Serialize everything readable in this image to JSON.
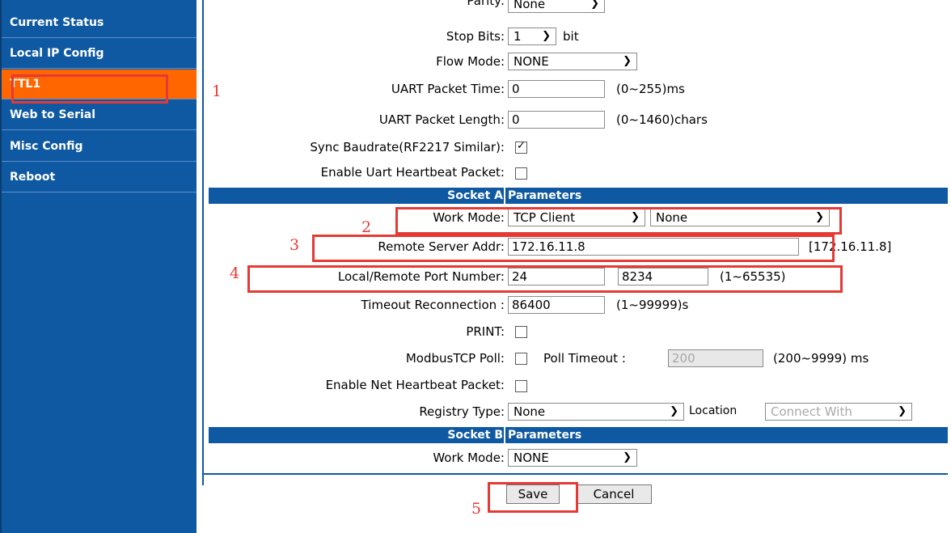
{
  "sidebar": {
    "items": [
      {
        "label": "Current Status",
        "active": false
      },
      {
        "label": "Local IP Config",
        "active": false
      },
      {
        "label": "TTL1",
        "active": true
      },
      {
        "label": "Web to Serial",
        "active": false
      },
      {
        "label": "Misc Config",
        "active": false
      },
      {
        "label": "Reboot",
        "active": false
      }
    ]
  },
  "uart": {
    "parity_label": "Parity:",
    "parity_value": "None",
    "stop_bits_label": "Stop Bits:",
    "stop_bits_value": "1",
    "stop_bits_unit": "bit",
    "flow_mode_label": "Flow Mode:",
    "flow_mode_value": "NONE",
    "packet_time_label": "UART Packet Time:",
    "packet_time_value": "0",
    "packet_time_range": "(0~255)ms",
    "packet_length_label": "UART Packet Length:",
    "packet_length_value": "0",
    "packet_length_range": "(0~1460)chars",
    "sync_baud_label": "Sync Baudrate(RF2217 Similar):",
    "sync_baud_checked": true,
    "uart_heartbeat_label": "Enable Uart Heartbeat Packet:",
    "uart_heartbeat_checked": false
  },
  "socket_a": {
    "header_left": "Socket A",
    "header_right": "Parameters",
    "work_mode_label": "Work Mode:",
    "work_mode_value": "TCP Client",
    "work_mode_secondary": "None",
    "remote_addr_label": "Remote Server Addr:",
    "remote_addr_value": "172.16.11.8",
    "remote_addr_echo": "[172.16.11.8]",
    "port_label": "Local/Remote Port Number:",
    "local_port": "24",
    "remote_port": "8234",
    "port_range": "(1~65535)",
    "timeout_label": "Timeout Reconnection :",
    "timeout_value": "86400",
    "timeout_range": "(1~99999)s",
    "print_label": "PRINT:",
    "print_checked": false,
    "modbus_label": "ModbusTCP Poll:",
    "modbus_checked": false,
    "poll_timeout_label": "Poll Timeout :",
    "poll_timeout_value": "200",
    "poll_timeout_range": "(200~9999) ms",
    "net_heartbeat_label": "Enable Net Heartbeat Packet:",
    "net_heartbeat_checked": false,
    "registry_label": "Registry Type:",
    "registry_value": "None",
    "location_label": "Location",
    "location_value": "Connect With"
  },
  "socket_b": {
    "header_left": "Socket B",
    "header_right": "Parameters",
    "work_mode_label": "Work Mode:",
    "work_mode_value": "NONE"
  },
  "actions": {
    "save_label": "Save",
    "cancel_label": "Cancel"
  },
  "annotations": [
    "1",
    "2",
    "3",
    "4",
    "5"
  ],
  "colors": {
    "sidebar": "#0f59a3",
    "active": "#ff6600",
    "annotation": "#e53935"
  }
}
